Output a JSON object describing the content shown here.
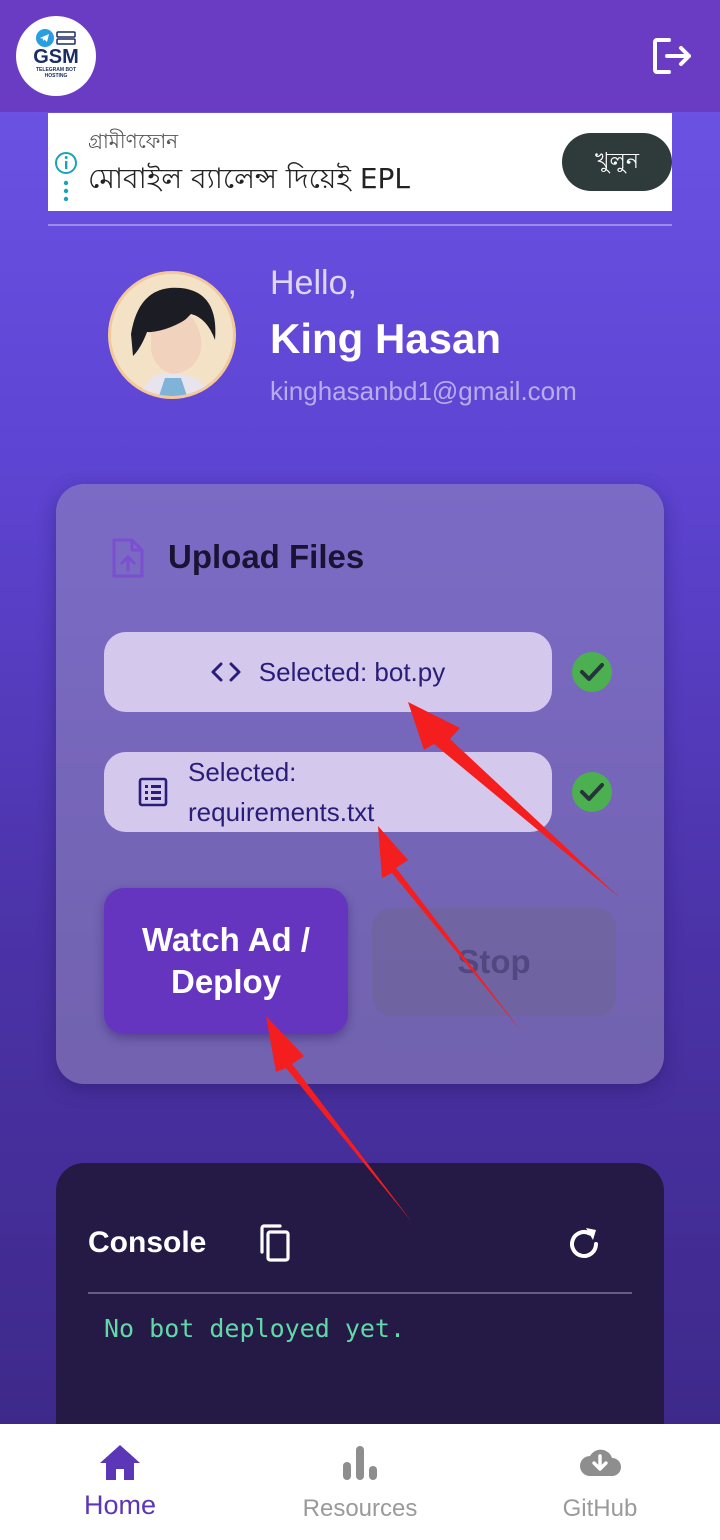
{
  "appbar": {
    "logo_text": "GSM",
    "logo_sub": "TELEGRAM BOT HOSTING",
    "logout_icon": "logout-icon"
  },
  "ad": {
    "brand": "গ্রামীণফোন",
    "title": "মোবাইল ব্যালেন্স দিয়েই EPL",
    "cta": "খুলুন"
  },
  "profile": {
    "greeting": "Hello,",
    "name": "King Hasan",
    "email": "kinghasanbd1@gmail.com"
  },
  "upload": {
    "title": "Upload Files",
    "files": [
      {
        "label": "Selected: bot.py",
        "icon": "code-icon",
        "status": "check-icon"
      },
      {
        "label_line1": "Selected:",
        "label_line2": "requirements.txt",
        "icon": "list-icon",
        "status": "check-icon"
      }
    ],
    "deploy_label": "Watch Ad / Deploy",
    "stop_label": "Stop"
  },
  "console": {
    "title": "Console",
    "output": "No bot deployed yet."
  },
  "nav": {
    "items": [
      {
        "label": "Home",
        "icon": "home-icon",
        "active": true
      },
      {
        "label": "Resources",
        "icon": "bar-chart-icon",
        "active": false
      },
      {
        "label": "GitHub",
        "icon": "cloud-download-icon",
        "active": false
      }
    ]
  },
  "colors": {
    "appbar": "#6a3cc4",
    "accent": "#6535c0",
    "check": "#4caf50",
    "console_text": "#62d7a8"
  }
}
